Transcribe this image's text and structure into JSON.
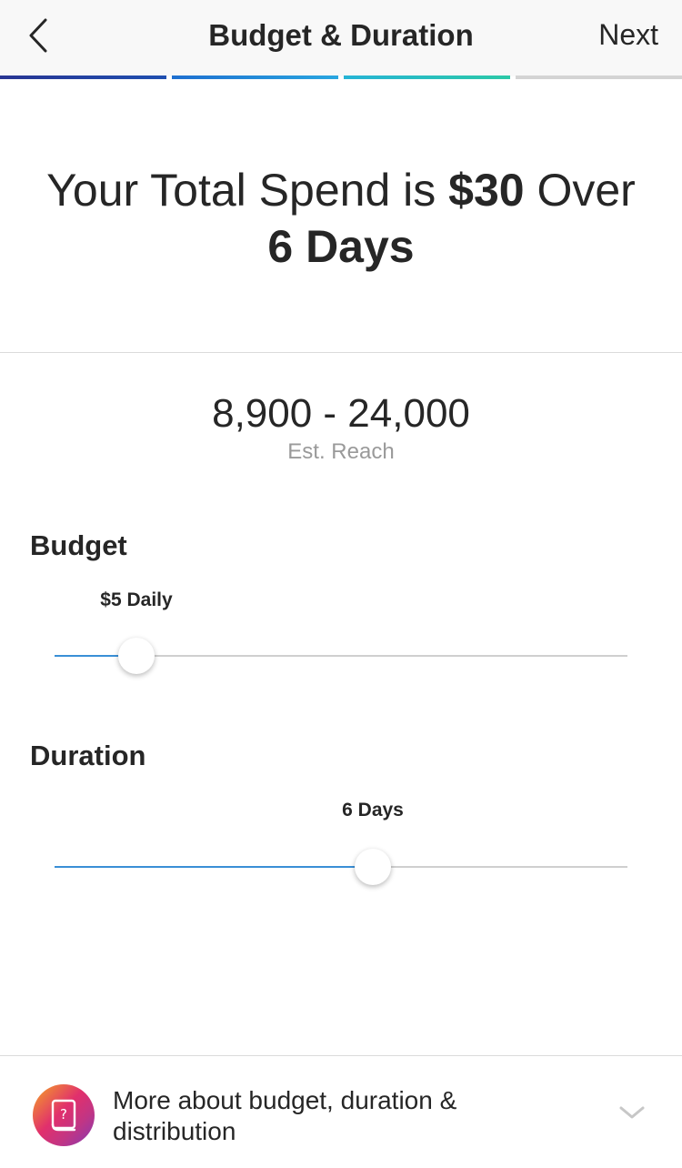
{
  "header": {
    "title": "Budget & Duration",
    "next_label": "Next"
  },
  "progress": {
    "completed_steps": 3,
    "total_steps": 4
  },
  "summary": {
    "prefix": "Your Total Spend is ",
    "amount": "$30",
    "middle": " Over",
    "duration": "6 Days"
  },
  "reach": {
    "value": "8,900 - 24,000",
    "label": "Est. Reach"
  },
  "budget": {
    "label": "Budget",
    "value_label": "$5 Daily",
    "slider_fraction": 0.143
  },
  "duration": {
    "label": "Duration",
    "value_label": "6 Days",
    "slider_fraction": 0.556
  },
  "footer": {
    "text": "More about budget, duration & distribution",
    "icon": "help-book-icon",
    "chevron_icon": "chevron-down-icon"
  },
  "colors": {
    "accent": "#3a8fd6",
    "track": "#cfcfcf",
    "text": "#262626",
    "muted": "#9a9a9a"
  }
}
